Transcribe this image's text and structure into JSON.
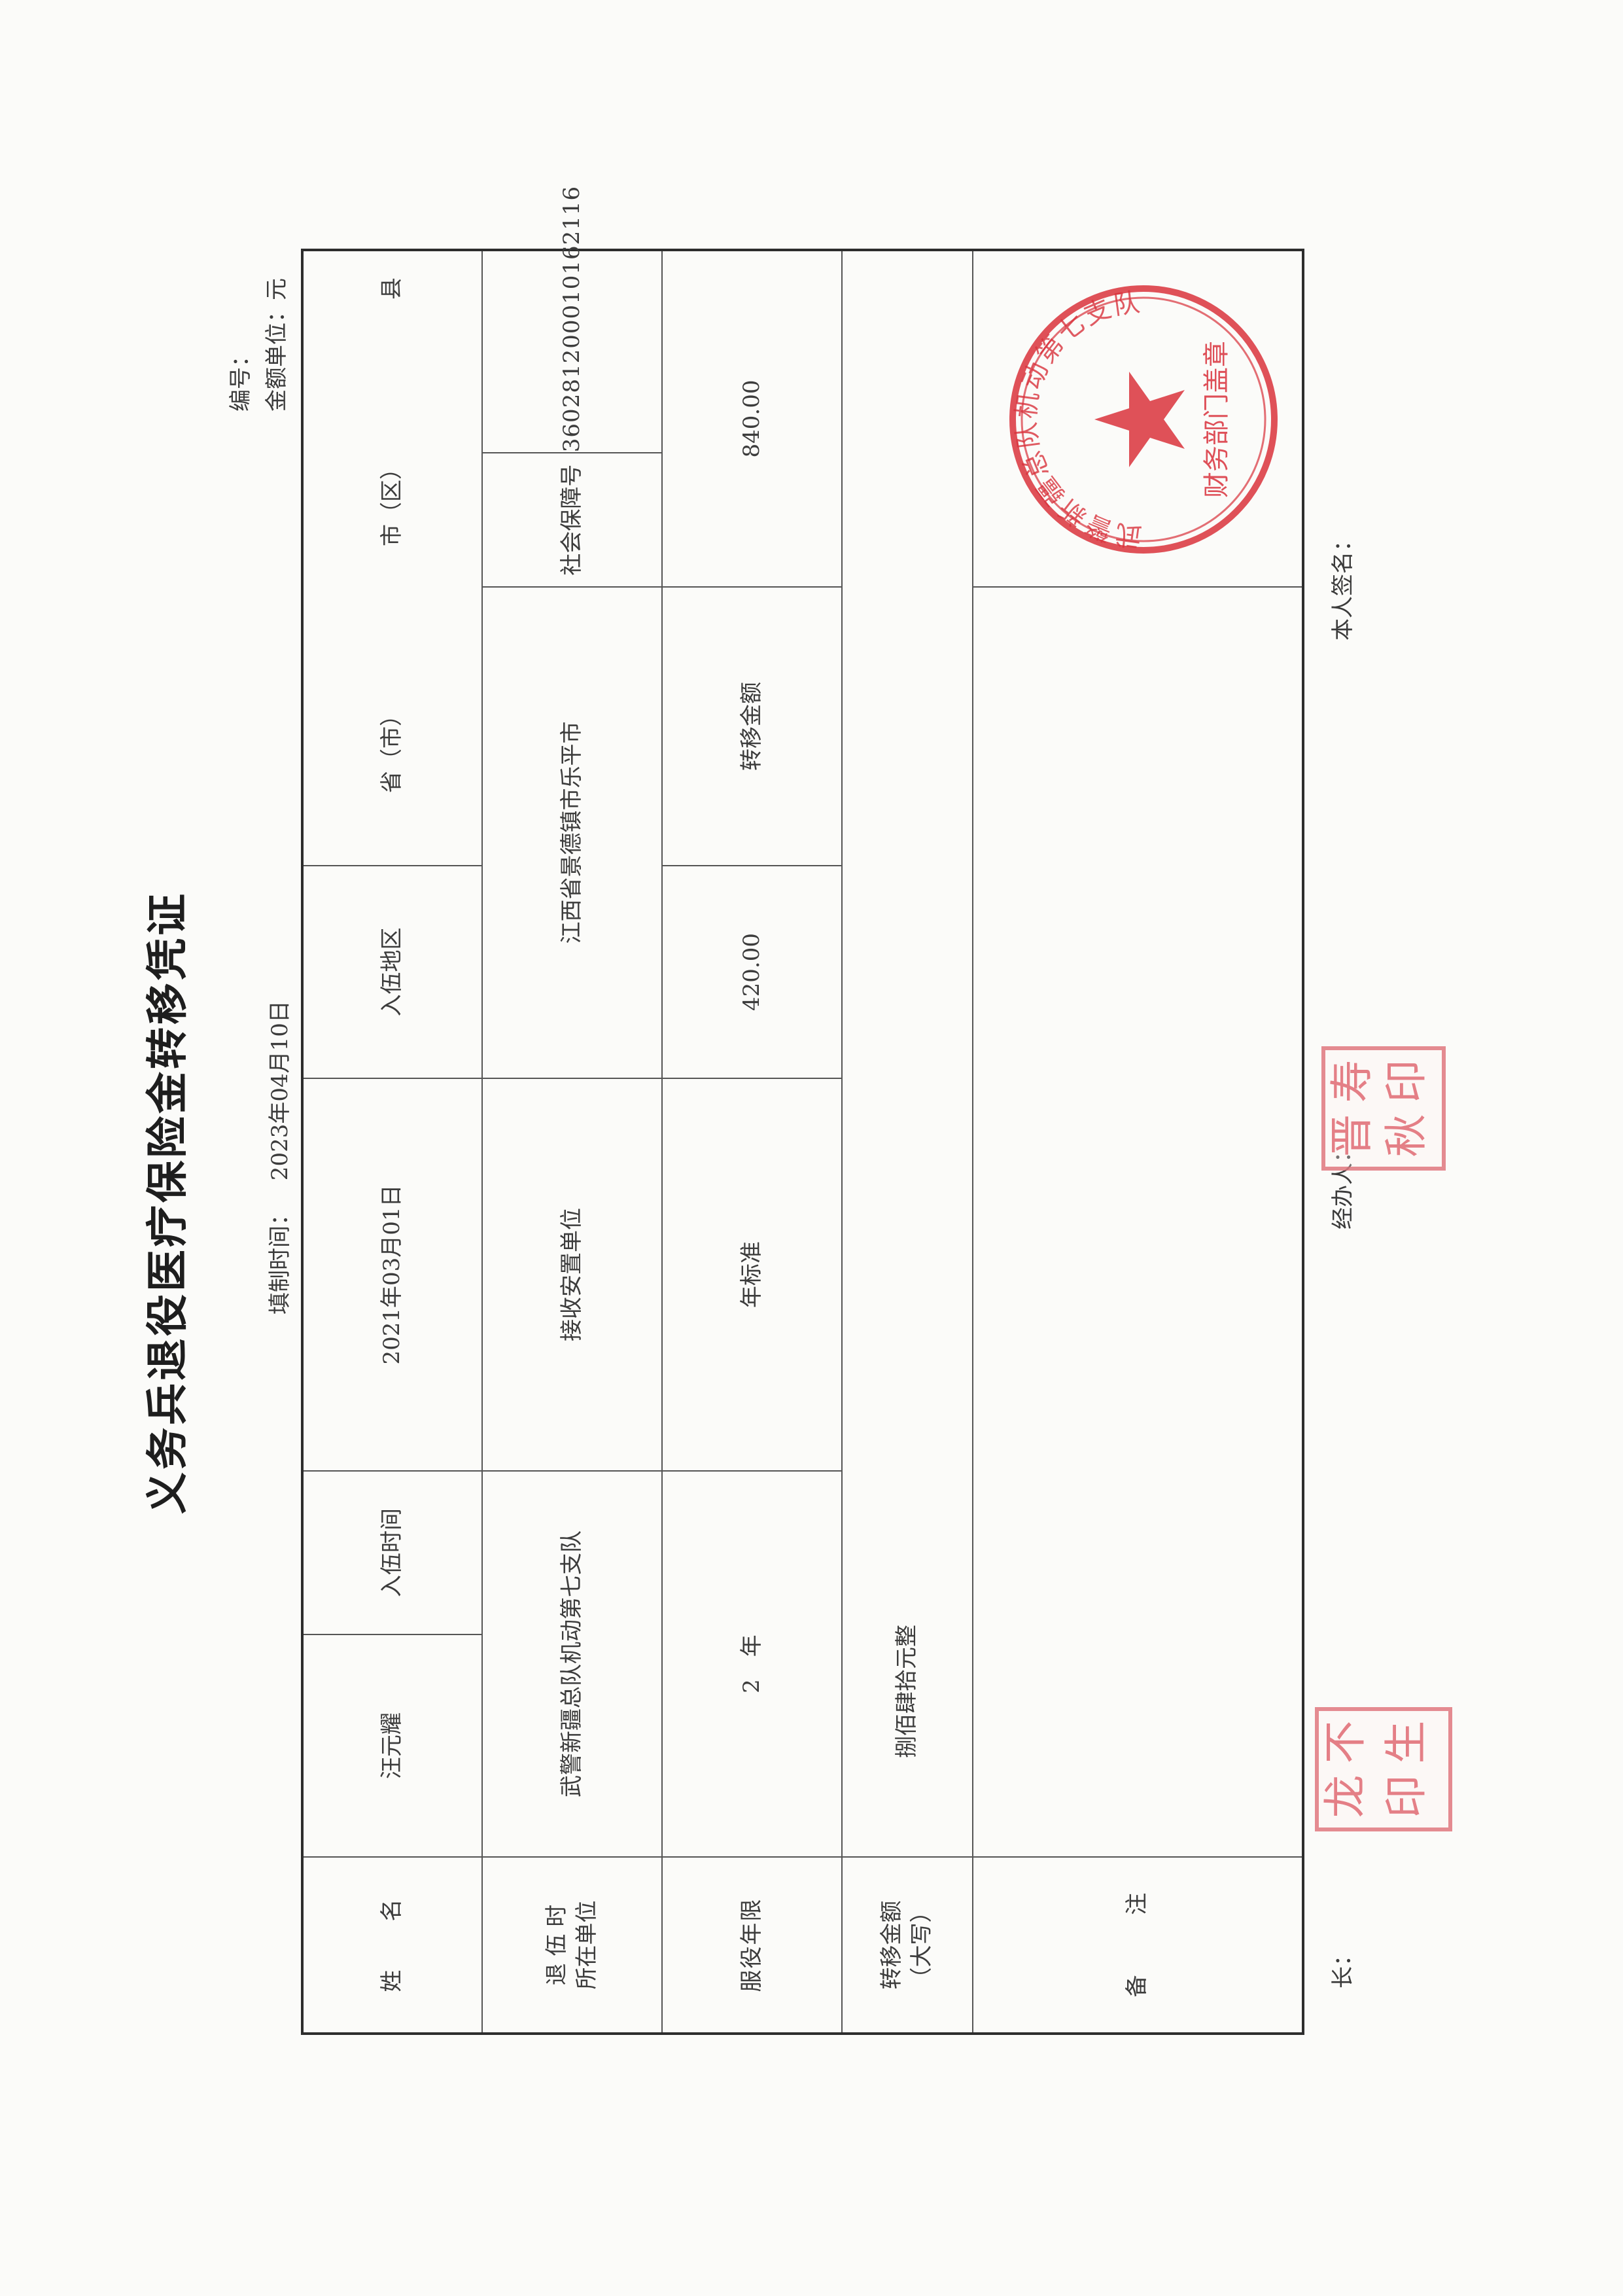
{
  "document": {
    "title": "义务兵退役医疗保险金转移凭证",
    "fill_time_label": "填制时间：",
    "fill_time_value": "2023年04月10日",
    "serial_label": "编号：",
    "unit_label": "金额单位：元"
  },
  "table": {
    "row1": {
      "name_label": "姓　　名",
      "name_value": "汪元耀",
      "enlist_time_label": "入伍时间",
      "enlist_time_value": "2021年03月01日",
      "enlist_region_label": "入伍地区",
      "province_suffix": "省（市）",
      "city_suffix": "市（区）",
      "county_suffix": "县"
    },
    "row2": {
      "unit_label_line1": "退 伍 时",
      "unit_label_line2": "所在单位",
      "unit_value": "武警新疆总队机动第七支队",
      "receiver_label": "接收安置单位",
      "receiver_value": "江西省景德镇市乐平市",
      "ssn_label": "社会保障号",
      "ssn_value": "360281200010162116"
    },
    "row3": {
      "years_label": "服役年限",
      "years_value": "2　年",
      "annual_std_label": "年标准",
      "annual_std_value": "420.00",
      "transfer_amount_label": "转移金额",
      "transfer_amount_value": "840.00"
    },
    "row4": {
      "capital_label_line1": "转移金额",
      "capital_label_line2": "（大写）",
      "capital_value": "捌佰肆拾元整"
    },
    "row5": {
      "remark_label_1": "备",
      "remark_label_2": "注",
      "seal_org": "武警新疆总队机动第七支队",
      "seal_dept": "财务部门盖章"
    }
  },
  "footer": {
    "chief_label": "长：",
    "handler_label": "经办人：",
    "self_sign_label": "本人签名："
  },
  "stamps": {
    "chief_stamp_chars": [
      "龙",
      "不",
      "印",
      "生"
    ],
    "handler_stamp_chars": [
      "晋",
      "寿",
      "秋",
      "印"
    ],
    "colors": {
      "stamp_red": "#e06a73",
      "seal_red": "#d9323c",
      "ink": "#3a3a3a"
    }
  }
}
